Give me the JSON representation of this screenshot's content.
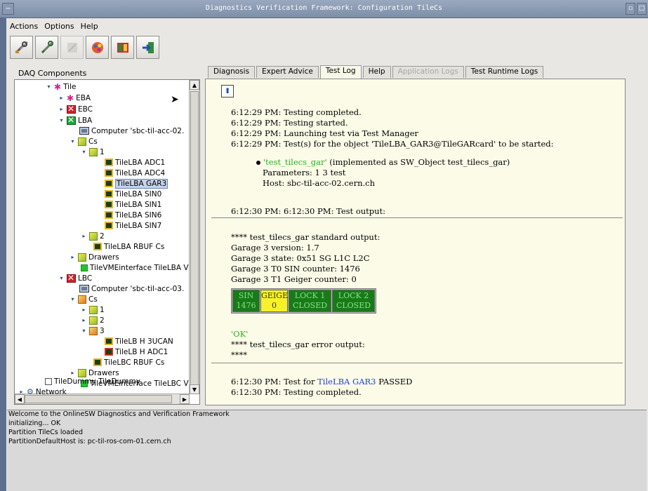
{
  "window": {
    "title": "Diagnostics Verification Framework: Configuration TileCs"
  },
  "menu": [
    "Actions",
    "Options",
    "Help"
  ],
  "toolbar": {
    "buttons": [
      "tools-icon",
      "wrench-icon",
      "disabled-tool-icon",
      "color-palette-icon",
      "book-icon",
      "exit-icon"
    ]
  },
  "tree": {
    "label": "DAQ Components",
    "items": [
      {
        "text": "Tile",
        "icon": "star-icon"
      },
      {
        "text": "EBA",
        "icon": "star-icon"
      },
      {
        "text": "EBC",
        "icon": "error-flag-icon"
      },
      {
        "text": "LBA",
        "icon": "ok-flag-icon"
      },
      {
        "text": "Computer 'sbc-til-acc-02.",
        "icon": "computer-icon"
      },
      {
        "text": "Cs",
        "icon": "cube-icon"
      },
      {
        "text": "1",
        "icon": "cube-icon"
      },
      {
        "text": "TileLBA ADC1",
        "icon": "chip-icon"
      },
      {
        "text": "TileLBA ADC4",
        "icon": "chip-icon"
      },
      {
        "text": "TileLBA GAR3",
        "icon": "chip-icon"
      },
      {
        "text": "TileLBA SIN0",
        "icon": "chip-icon"
      },
      {
        "text": "TileLBA SIN1",
        "icon": "chip-icon"
      },
      {
        "text": "TileLBA SIN6",
        "icon": "chip-icon"
      },
      {
        "text": "TileLBA SIN7",
        "icon": "chip-icon"
      },
      {
        "text": "2",
        "icon": "cube-icon"
      },
      {
        "text": "TileLBA RBUF Cs",
        "icon": "chip-icon"
      },
      {
        "text": "Drawers",
        "icon": "cube-icon"
      },
      {
        "text": "TileVMEinterface TileLBA V",
        "icon": "green-square-icon"
      },
      {
        "text": "LBC",
        "icon": "error-flag-icon"
      },
      {
        "text": "Computer 'sbc-til-acc-03.",
        "icon": "computer-icon"
      },
      {
        "text": "Cs",
        "icon": "cube-icon"
      },
      {
        "text": "1",
        "icon": "cube-icon"
      },
      {
        "text": "2",
        "icon": "cube-icon"
      },
      {
        "text": "3",
        "icon": "cube-icon"
      },
      {
        "text": "TileLB H 3UCAN",
        "icon": "chip-icon"
      },
      {
        "text": "TileLB H ADC1",
        "icon": "chip-icon"
      },
      {
        "text": "TileLBC RBUF Cs",
        "icon": "chip-icon"
      },
      {
        "text": "Drawers",
        "icon": "cube-icon"
      },
      {
        "text": "TileVMEinterface TileLBC V",
        "icon": "green-square-icon"
      },
      {
        "text": "TileDummy TileDummy",
        "icon": "empty-box-icon"
      },
      {
        "text": "Network",
        "icon": "network-icon"
      }
    ]
  },
  "tabs": [
    "Diagnosis",
    "Expert Advice",
    "Test Log",
    "Help",
    "Application Logs",
    "Test Runtime Logs"
  ],
  "log": {
    "block1": [
      "6:12:29 PM: Testing completed.",
      "6:12:29 PM: Testing started.",
      "6:12:29 PM: Launching test via Test Manager",
      "6:12:29 PM: Test(s) for the object 'TileLBA_GAR3@TileGARcard' to be started:"
    ],
    "bullet_link": "'test_tilecs_gar'",
    "bullet_rest": " (implemented as SW_Object test_tilecs_gar)",
    "parameters": "Parameters: 1 3 test",
    "host": "Host: sbc-til-acc-02.cern.ch",
    "output_header": "6:12:30 PM: 6:12:30 PM: Test output:",
    "block2": [
      "**** test_tilecs_gar standard output:",
      "Garage 3 version: 1.7",
      "Garage 3 state: 0x51 SG L1C L2C",
      "Garage 3 T0 SIN counter: 1476",
      "Garage 3 T1 Geiger counter: 0"
    ],
    "status_cells": [
      {
        "line1": "SIN",
        "line2": "1476"
      },
      {
        "line1": "GEIGER",
        "line2": "0"
      },
      {
        "line1": "LOCK 1",
        "line2": "CLOSED"
      },
      {
        "line1": "LOCK 2",
        "line2": "CLOSED"
      }
    ],
    "ok_text": "'OK'",
    "error_output": "**** test_tilecs_gar error output:",
    "stars": "****",
    "result_prefix": "6:12:30 PM: Test for ",
    "result_link": "TileLBA GAR3",
    "result_suffix": " PASSED",
    "final": "6:12:30 PM: Testing completed."
  },
  "console": [
    "Welcome to the OnlineSW Diagnostics and Verification Framework",
    "initializing... OK",
    "Partition TileCs loaded",
    "PartitionDefaultHost is: pc-til-ros-com-01.cern.ch"
  ],
  "colors": {
    "accent": "#1d3fd6",
    "ok_green": "#25b321",
    "status_green": "#1a7a1a",
    "status_yellow": "#f7f12a"
  }
}
